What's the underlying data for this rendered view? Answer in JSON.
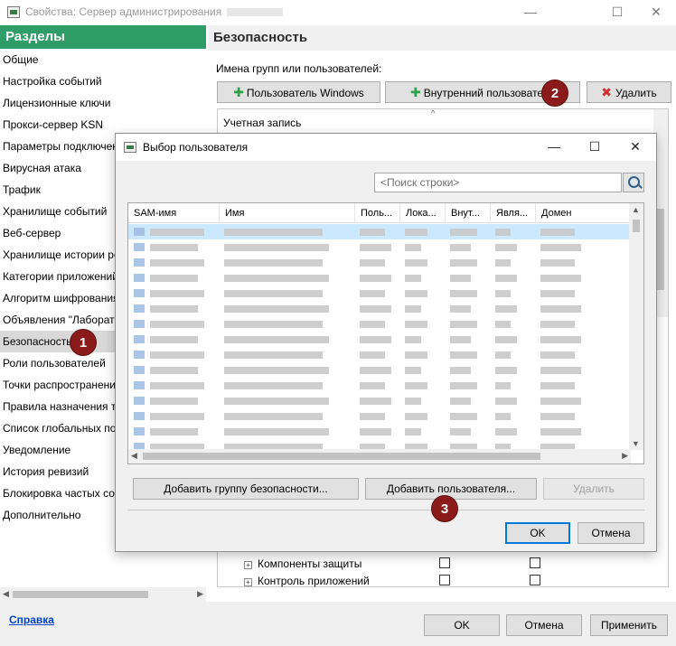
{
  "window": {
    "title": "Свойства: Сервер администрирования",
    "controls": {
      "minimize": "—",
      "maximize": "☐",
      "close": "✕"
    }
  },
  "sidebar": {
    "heading": "Разделы",
    "items": [
      {
        "label": "Общие"
      },
      {
        "label": "Настройка событий"
      },
      {
        "label": "Лицензионные ключи"
      },
      {
        "label": "Прокси-сервер KSN"
      },
      {
        "label": "Параметры подключени"
      },
      {
        "label": "Вирусная атака"
      },
      {
        "label": "Трафик"
      },
      {
        "label": "Хранилище событий"
      },
      {
        "label": "Веб-сервер"
      },
      {
        "label": "Хранилище истории реві"
      },
      {
        "label": "Категории приложений"
      },
      {
        "label": "Алгоритм шифрования"
      },
      {
        "label": "Объявления \"Лаборатор"
      },
      {
        "label": "Безопасность",
        "selected": true
      },
      {
        "label": "Роли пользователей"
      },
      {
        "label": "Точки распространения"
      },
      {
        "label": "Правила назначения тег"
      },
      {
        "label": "Список глобальных подс"
      },
      {
        "label": "Уведомление"
      },
      {
        "label": "История ревизий"
      },
      {
        "label": "Блокировка частых собь"
      },
      {
        "label": "Дополнительно"
      }
    ]
  },
  "security": {
    "heading": "Безопасность",
    "groups_label": "Имена групп или пользователей:",
    "btn_windows_user": "Пользователь Windows",
    "btn_internal_user": "Внутренний пользователь",
    "btn_delete": "Удалить",
    "account_column": "Учетная запись",
    "permissions": [
      {
        "label": "Компоненты защиты"
      },
      {
        "label": "Контроль приложений"
      }
    ]
  },
  "dialog": {
    "title": "Выбор пользователя",
    "search_placeholder": "<Поиск строки>",
    "columns": [
      "SAM-имя",
      "Имя",
      "Поль...",
      "Лока...",
      "Внут...",
      "Явля...",
      "Домен"
    ],
    "btn_add_group": "Добавить группу безопасности...",
    "btn_add_user": "Добавить пользователя...",
    "btn_delete": "Удалить",
    "btn_ok": "OK",
    "btn_cancel": "Отмена"
  },
  "footer": {
    "help": "Справка",
    "ok": "OK",
    "cancel": "Отмена",
    "apply": "Применить"
  },
  "badges": [
    "1",
    "2",
    "3"
  ],
  "colors": {
    "sidebar_header": "#2f9d67",
    "selection": "#cce8ff",
    "badge": "#8b1a1a",
    "link": "#0044cc"
  }
}
